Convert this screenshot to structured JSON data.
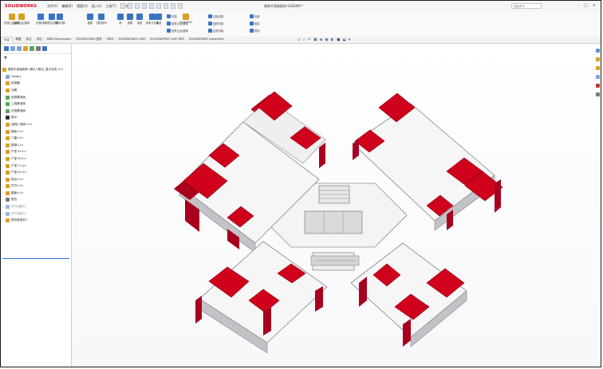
{
  "app": {
    "logo_text": "SOLIDWORKS",
    "menu": [
      "文件(F)",
      "编辑(E)",
      "视图(V)",
      "插入(I)",
      "工具(T)",
      "窗口(W)",
      "?"
    ],
    "document_title": "建筑平面装配体.SLDASM *",
    "search_placeholder": "搜索命令",
    "window_buttons": [
      "–",
      "□",
      "×"
    ]
  },
  "ribbon": {
    "large_buttons": [
      {
        "label": "拉伸凸台/基体",
        "icon": "extrude-boss-icon",
        "color": "#d8a021"
      },
      {
        "label": "旋转凸台/基体",
        "icon": "revolve-boss-icon",
        "color": "#d8a021"
      },
      {
        "label": "拉伸切除",
        "icon": "extrude-cut-icon",
        "color": "#3b73c4"
      },
      {
        "label": "异型孔向导",
        "icon": "hole-wizard-icon",
        "color": "#3b73c4"
      },
      {
        "label": "旋转切除",
        "icon": "revolve-cut-icon",
        "color": "#3b73c4"
      },
      {
        "label": "圆角",
        "icon": "fillet-icon",
        "color": "#3b73c4"
      },
      {
        "label": "线性阵列",
        "icon": "linear-pattern-icon",
        "color": "#3b73c4"
      },
      {
        "label": "筋",
        "icon": "rib-icon",
        "color": "#3b73c4"
      },
      {
        "label": "拔模",
        "icon": "draft-icon",
        "color": "#3b73c4"
      },
      {
        "label": "抽壳",
        "icon": "shell-icon",
        "color": "#3b73c4"
      },
      {
        "label": "参考几何体",
        "icon": "reference-geometry-icon",
        "color": "#3b73c4"
      },
      {
        "label": "曲线",
        "icon": "curves-icon",
        "color": "#3b73c4"
      },
      {
        "label": "Instant3D",
        "icon": "instant3d-icon",
        "color": "#d8a021"
      }
    ],
    "small_rows": [
      {
        "label": "扫描",
        "icon": "sweep-icon"
      },
      {
        "label": "放样凸台/基体",
        "icon": "loft-icon"
      },
      {
        "label": "边界凸台/基体",
        "icon": "boundary-icon"
      },
      {
        "label": "扫描切除",
        "icon": "sweep-cut-icon"
      },
      {
        "label": "放样切割",
        "icon": "loft-cut-icon"
      },
      {
        "label": "边界切除",
        "icon": "boundary-cut-icon"
      },
      {
        "label": "包覆",
        "icon": "wrap-icon"
      },
      {
        "label": "相交",
        "icon": "intersect-icon"
      },
      {
        "label": "镜向",
        "icon": "mirror-icon"
      }
    ]
  },
  "tabs": [
    {
      "label": "特征",
      "active": true
    },
    {
      "label": "草图",
      "active": false
    },
    {
      "label": "标注",
      "active": false
    },
    {
      "label": "评估",
      "active": false
    },
    {
      "label": "MBD Dimensions",
      "active": false
    },
    {
      "label": "SOLIDWORKS 插件",
      "active": false
    },
    {
      "label": "MBD",
      "active": false
    },
    {
      "label": "SOLIDWORKS CAM",
      "active": false
    },
    {
      "label": "SOLIDWORKS CAM TBM",
      "active": false
    },
    {
      "label": "SOLIDWORKS Inspection",
      "active": false
    }
  ],
  "feature_tree": {
    "root": "建筑平面装配体 (默认<默认_显示状态-1>)",
    "items": [
      {
        "label": "History",
        "expandable": true,
        "dim": false
      },
      {
        "label": "传感器",
        "expandable": false,
        "dim": false
      },
      {
        "label": "注解",
        "expandable": true,
        "dim": false
      },
      {
        "label": "前视基准面",
        "expandable": false,
        "dim": false
      },
      {
        "label": "上视基准面",
        "expandable": false,
        "dim": false
      },
      {
        "label": "右视基准面",
        "expandable": false,
        "dim": false
      },
      {
        "label": "原点",
        "expandable": false,
        "dim": false
      },
      {
        "label": "(固定) 墙体<1>",
        "expandable": true,
        "dim": false
      },
      {
        "label": "楼板<1>",
        "expandable": true,
        "dim": false
      },
      {
        "label": "门窗<1>",
        "expandable": true,
        "dim": false
      },
      {
        "label": "楼梯<1>",
        "expandable": true,
        "dim": false
      },
      {
        "label": "户型 A<1>",
        "expandable": true,
        "dim": false
      },
      {
        "label": "户型 B<1>",
        "expandable": true,
        "dim": false
      },
      {
        "label": "户型 C<1>",
        "expandable": true,
        "dim": false
      },
      {
        "label": "户型 D<1>",
        "expandable": true,
        "dim": false
      },
      {
        "label": "阳台<1>",
        "expandable": true,
        "dim": false
      },
      {
        "label": "栏杆<1>",
        "expandable": true,
        "dim": false
      },
      {
        "label": "屋面<1>",
        "expandable": true,
        "dim": false
      },
      {
        "label": "配合",
        "expandable": true,
        "dim": false
      },
      {
        "label": "阵列(圆周)1",
        "expandable": true,
        "dim": true
      },
      {
        "label": "阵列(圆周)2",
        "expandable": true,
        "dim": true
      },
      {
        "label": "镜向零部件1",
        "expandable": true,
        "dim": false
      }
    ]
  },
  "colors": {
    "roof_red": "#d0021b",
    "wall_crimson": "#a8001e",
    "wall_grey": "#c9c9cc",
    "floor_white": "#f7f7f7",
    "accent_blue": "#2f6fd8"
  }
}
